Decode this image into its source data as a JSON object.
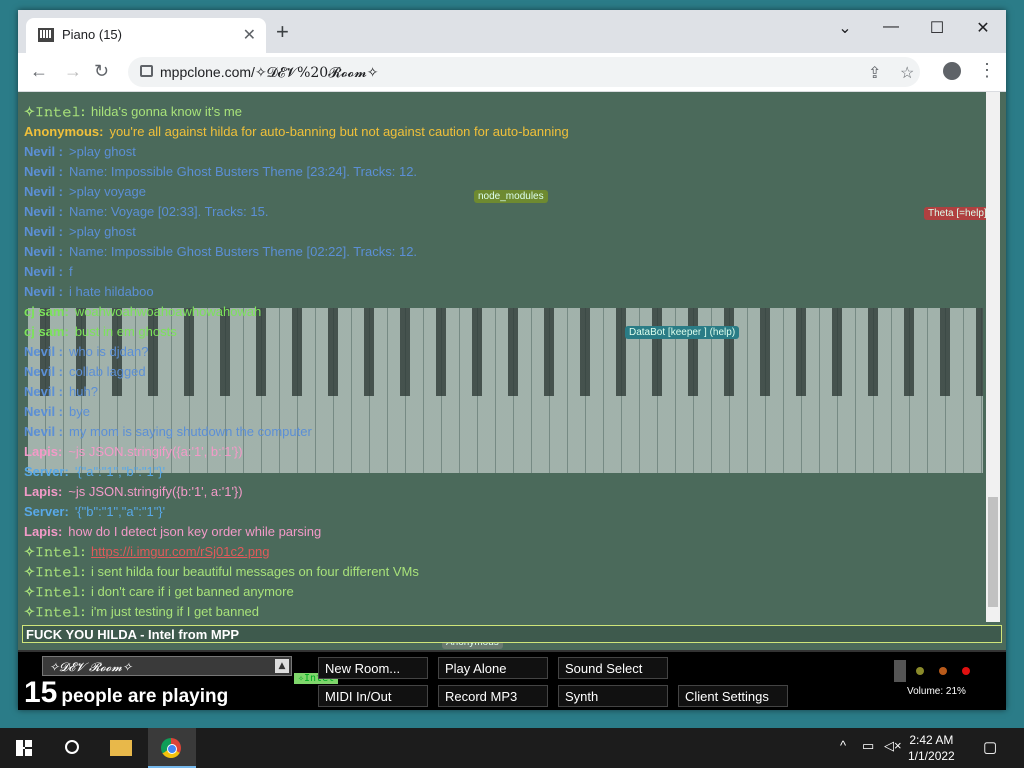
{
  "browser": {
    "tab_title": "Piano (15)",
    "new_tab": "+",
    "url_prefix": "mppclone.com/",
    "url_room": "✧𝓓𝓔𝓥%20𝓡𝓸𝓸𝓶✧"
  },
  "chat": {
    "messages": [
      {
        "name": "✧𝙸𝚗𝚝𝚎𝚕:",
        "text": "hilda's gonna know it's me",
        "color": "#a8e27a"
      },
      {
        "name": "Anonymous:",
        "text": "you're all against hilda for auto-banning but not against caution for auto-banning",
        "color": "#f0c03a"
      },
      {
        "name": "Nevil :",
        "text": ">play ghost",
        "color": "#5b8fd6"
      },
      {
        "name": "Nevil :",
        "text": "Name: Impossible Ghost Busters Theme [23:24]. Tracks: 12.",
        "color": "#5b8fd6"
      },
      {
        "name": "Nevil :",
        "text": ">play voyage",
        "color": "#5b8fd6"
      },
      {
        "name": "Nevil :",
        "text": "Name: Voyage [02:33]. Tracks: 15.",
        "color": "#5b8fd6"
      },
      {
        "name": "Nevil :",
        "text": ">play ghost",
        "color": "#5b8fd6"
      },
      {
        "name": "Nevil :",
        "text": "Name: Impossible Ghost Busters Theme [02:22]. Tracks: 12.",
        "color": "#5b8fd6"
      },
      {
        "name": "Nevil :",
        "text": "f",
        "color": "#5b8fd6"
      },
      {
        "name": "Nevil :",
        "text": "i hate hildaboo",
        "color": "#5b8fd6"
      },
      {
        "name": "cj sam:",
        "text": "woahwoahwoahoawhowahowah",
        "color": "#7ce35a"
      },
      {
        "name": "cj sam:",
        "text": "bust in em ghosts",
        "color": "#7ce35a"
      },
      {
        "name": "Nevil :",
        "text": "who is djdan?",
        "color": "#5b8fd6"
      },
      {
        "name": "Nevil :",
        "text": "collab lagged",
        "color": "#5b8fd6"
      },
      {
        "name": "Nevil :",
        "text": "huh?",
        "color": "#5b8fd6"
      },
      {
        "name": "Nevil :",
        "text": "bye",
        "color": "#5b8fd6"
      },
      {
        "name": "Nevil :",
        "text": "my mom is saying shutdown the computer",
        "color": "#5b8fd6"
      },
      {
        "name": "Lapis:",
        "text": "~js JSON.stringify({a:'1', b:'1'})",
        "color": "#f39ac8"
      },
      {
        "name": "Server:",
        "text": "'{\"a\":\"1\",\"b\":\"1\"}'",
        "color": "#58a8e8"
      },
      {
        "name": "Lapis:",
        "text": "~js JSON.stringify({b:'1', a:'1'})",
        "color": "#f39ac8"
      },
      {
        "name": "Server:",
        "text": "'{\"b\":\"1\",\"a\":\"1\"}'",
        "color": "#58a8e8"
      },
      {
        "name": "Lapis:",
        "text": "how do I detect json key order while parsing",
        "color": "#f39ac8"
      },
      {
        "name": "✧𝙸𝚗𝚝𝚎𝚕:",
        "text": "https://i.imgur.com/rSj01c2.png",
        "color": "#a8e27a",
        "link": true
      },
      {
        "name": "✧𝙸𝚗𝚝𝚎𝚕:",
        "text": "i sent hilda four beautiful messages on four different VMs",
        "color": "#a8e27a"
      },
      {
        "name": "✧𝙸𝚗𝚝𝚎𝚕:",
        "text": "i don't care if i get banned anymore",
        "color": "#a8e27a"
      },
      {
        "name": "✧𝙸𝚗𝚝𝚎𝚕:",
        "text": "i'm just testing if I get banned",
        "color": "#a8e27a"
      }
    ],
    "input_value": "FUCK YOU HILDA - Intel from MPP"
  },
  "cursor_tags": [
    {
      "text": "DataBot [keeper ] (help)",
      "color": "#2a7c86"
    },
    {
      "text": "node_modules",
      "color": "#6e8a30"
    },
    {
      "text": "Anonymous",
      "color": "#6a7a70"
    },
    {
      "text": "Theta [=help]",
      "color": "#b04040"
    }
  ],
  "controls": {
    "room_name": "✧𝓓𝓔𝓥 𝓡𝓸𝓸𝓶✧",
    "player_count": "15",
    "players_label": "people are playing",
    "buttons": {
      "new_room": "New Room...",
      "play_alone": "Play Alone",
      "sound_select": "Sound Select",
      "midi": "MIDI In/Out",
      "record": "Record MP3",
      "synth": "Synth",
      "client_settings": "Client Settings"
    },
    "intel_tag": "✧𝙸𝚗𝚝𝚎𝚕",
    "volume": "Volume: 21%"
  },
  "taskbar": {
    "time": "2:42 AM",
    "date": "1/1/2022"
  }
}
